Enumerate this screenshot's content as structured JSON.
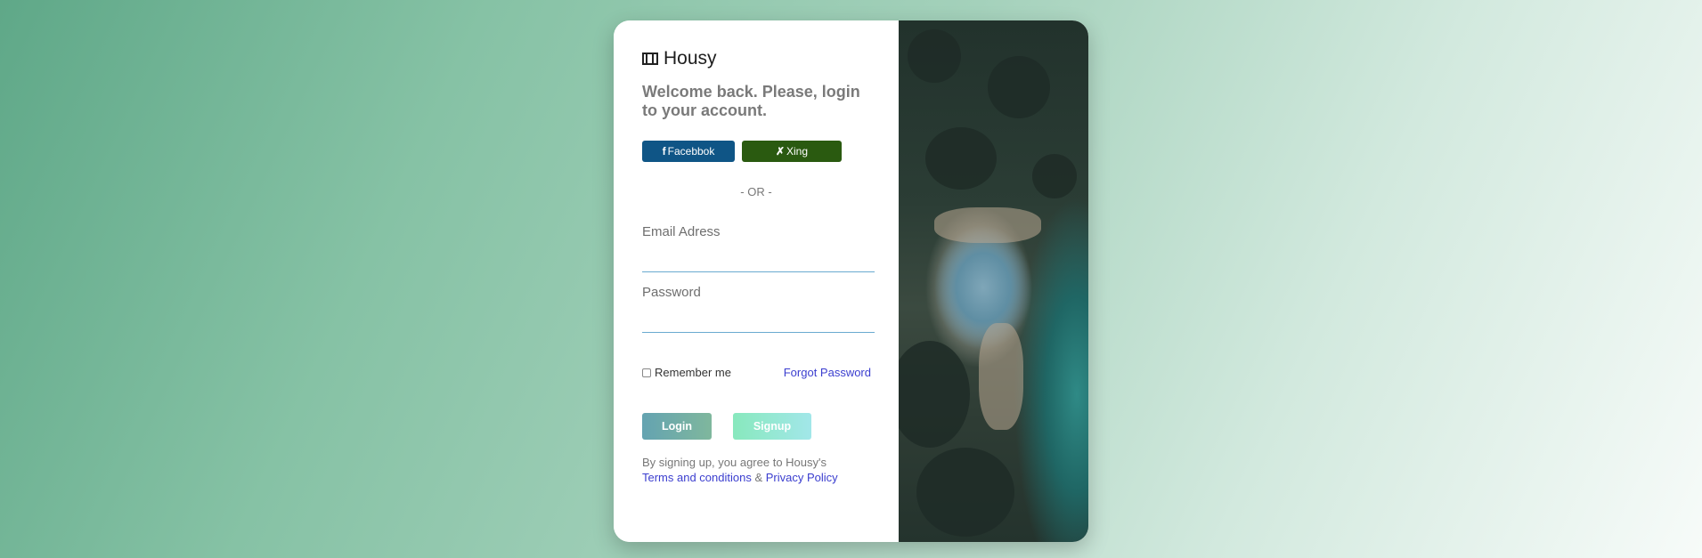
{
  "brand": {
    "icon": "film-icon",
    "name": "Housy"
  },
  "welcome": "Welcome back. Please, login to your account.",
  "social": {
    "facebook": {
      "icon": "facebook-icon",
      "label": "Facebbok",
      "color": "#0f5586"
    },
    "xing": {
      "icon": "xing-icon",
      "label": "Xing",
      "color": "#2a5a10"
    }
  },
  "divider": "- OR -",
  "form": {
    "email_label": "Email Adress",
    "email_value": "",
    "password_label": "Password",
    "password_value": ""
  },
  "options": {
    "remember_label": "Remember me",
    "remember_checked": false,
    "forgot_label": "Forgot Password"
  },
  "actions": {
    "login_label": "Login",
    "signup_label": "Signup"
  },
  "terms": {
    "prefix": "By signing up, you agree to Housy's",
    "terms_link": "Terms and conditions",
    "and": "&",
    "privacy_link": "Privacy Policy"
  },
  "colors": {
    "link": "#3b3ecf",
    "input_underline": "#6aaad0"
  }
}
